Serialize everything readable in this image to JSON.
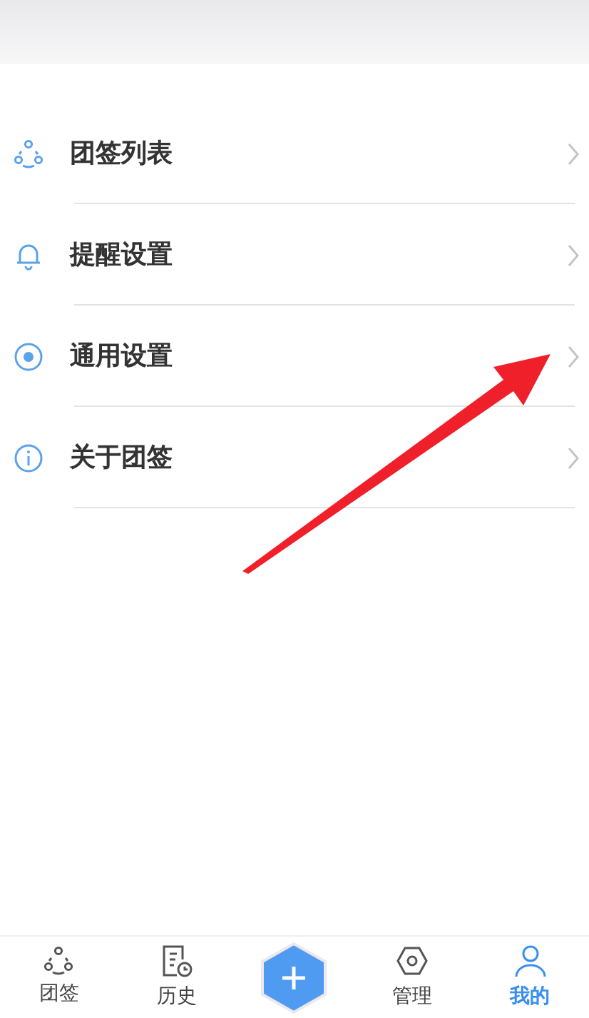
{
  "menu": [
    {
      "label": "团签列表",
      "kind": "group"
    },
    {
      "label": "提醒设置",
      "kind": "bell"
    },
    {
      "label": "通用设置",
      "kind": "dot"
    },
    {
      "label": "关于团签",
      "kind": "info"
    }
  ],
  "tabs": [
    {
      "label": "团签",
      "kind": "group",
      "selected": false
    },
    {
      "label": "历史",
      "kind": "history",
      "selected": false
    },
    {
      "kind": "add"
    },
    {
      "label": "管理",
      "kind": "manage",
      "selected": false
    },
    {
      "label": "我的",
      "kind": "person",
      "selected": true
    }
  ]
}
